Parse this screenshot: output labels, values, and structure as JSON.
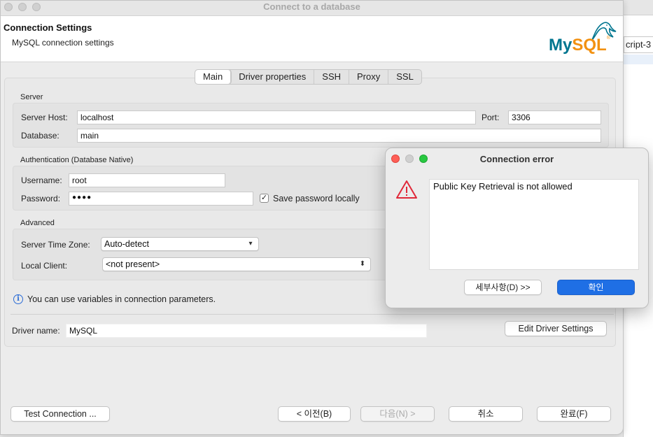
{
  "window": {
    "title": "Connect to a database",
    "traffic_color": "#d0d0d0"
  },
  "header": {
    "title": "Connection Settings",
    "subtitle": "MySQL connection settings",
    "logo_my": "My",
    "logo_sql": "SQL",
    "logo_tm": "®",
    "brand_blue": "#00758f",
    "brand_orange": "#f29111"
  },
  "background_app": {
    "tab_label": "cript-3"
  },
  "tabs": [
    {
      "label": "Main",
      "active": true
    },
    {
      "label": "Driver properties",
      "active": false
    },
    {
      "label": "SSH",
      "active": false
    },
    {
      "label": "Proxy",
      "active": false
    },
    {
      "label": "SSL",
      "active": false
    }
  ],
  "server": {
    "group_label": "Server",
    "host_label": "Server Host:",
    "host_value": "localhost",
    "port_label": "Port:",
    "port_value": "3306",
    "database_label": "Database:",
    "database_value": "main"
  },
  "auth": {
    "group_label": "Authentication (Database Native)",
    "username_label": "Username:",
    "username_value": "root",
    "password_label": "Password:",
    "password_value": "●●●●",
    "save_password_label": "Save password locally",
    "save_password_checked": "✓"
  },
  "advanced": {
    "group_label": "Advanced",
    "timezone_label": "Server Time Zone:",
    "timezone_value": "Auto-detect",
    "local_client_label": "Local Client:",
    "local_client_value": "<not present>"
  },
  "info": {
    "icon": "info-icon",
    "glyph": "i",
    "text": "You can use variables in connection parameters."
  },
  "driver": {
    "label": "Driver name:",
    "value": "MySQL",
    "edit_button": "Edit Driver Settings"
  },
  "footer": {
    "test_connection": "Test Connection ...",
    "back": "< 이전(B)",
    "next": "다음(N) >",
    "cancel": "취소",
    "finish": "완료(F)"
  },
  "dialog": {
    "title": "Connection error",
    "message": "Public Key Retrieval is not allowed",
    "details_button": "세부사항(D) >>",
    "ok_button": "확인",
    "close_color": "#fe5f57",
    "minimize_color": "#d0d0d0",
    "zoom_color": "#28c840",
    "warning_color": "#e0293a",
    "accent": "#1f6fe5"
  }
}
